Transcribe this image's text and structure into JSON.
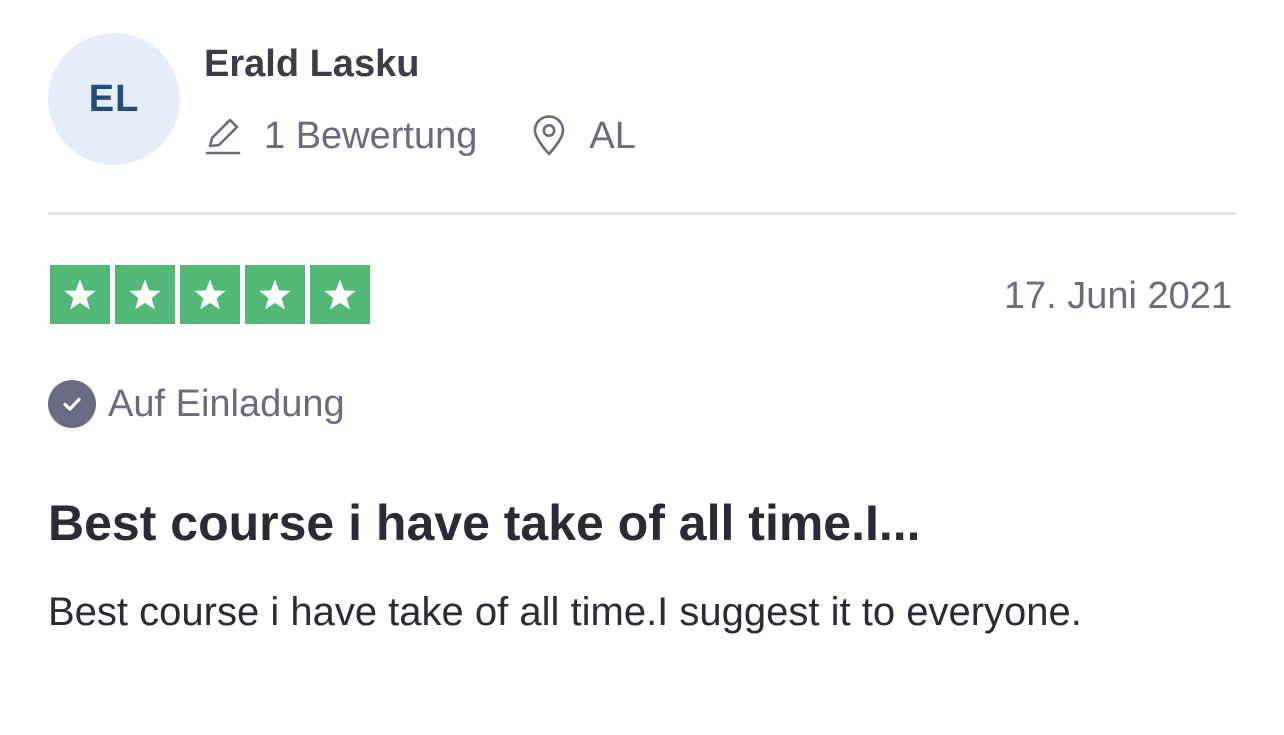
{
  "reviewer": {
    "initials": "EL",
    "name": "Erald Lasku",
    "review_count": "1 Bewertung",
    "location": "AL"
  },
  "rating": {
    "stars": 5,
    "max_stars": 5,
    "star_color": "#53b877",
    "date": "17. Juni 2021"
  },
  "badge": {
    "label": "Auf Einladung",
    "icon": "check-circle-icon"
  },
  "review": {
    "title": "Best course i have take of all time.I...",
    "body": "Best course i have take of all time.I suggest it to everyone."
  },
  "colors": {
    "avatar_bg": "#e5eef8",
    "avatar_text": "#244b7f",
    "muted_text": "#6b6b80",
    "main_text": "#2b2b36"
  }
}
